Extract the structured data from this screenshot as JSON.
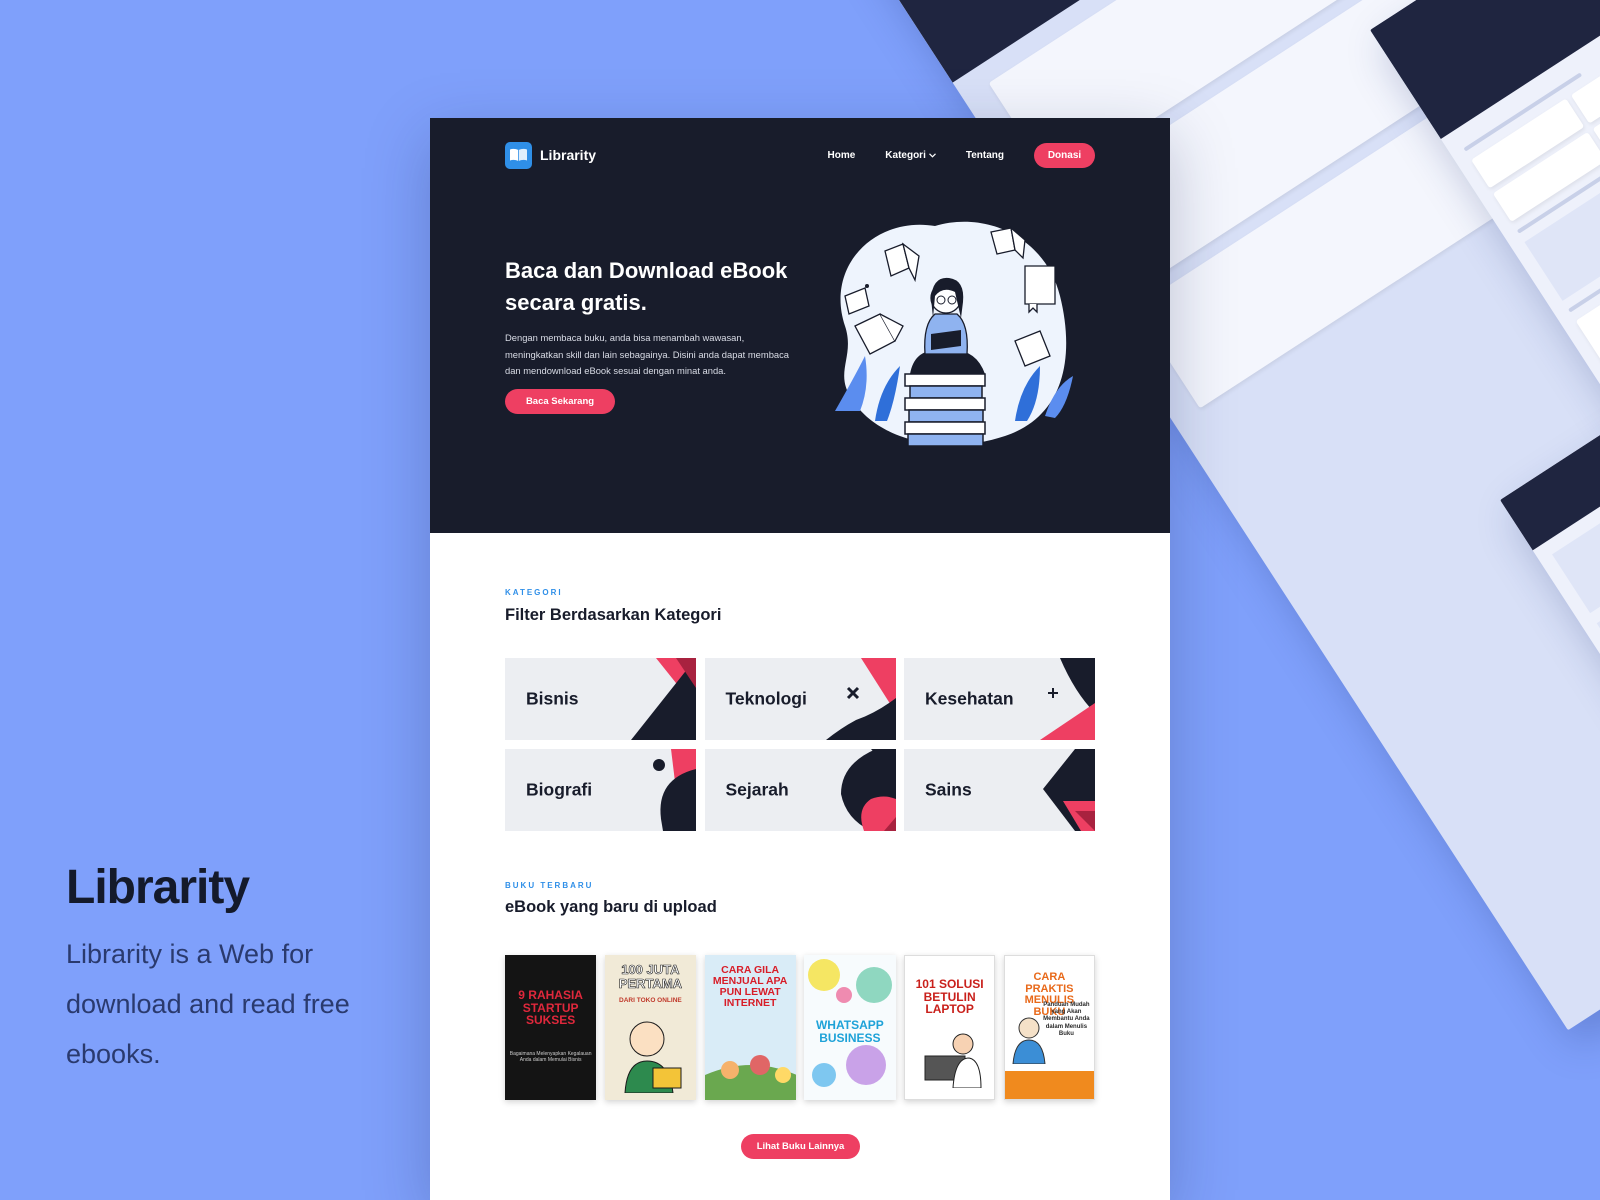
{
  "caption": {
    "title": "Librarity",
    "description": "Librarity is a Web for download and read free ebooks."
  },
  "nav": {
    "brand": "Librarity",
    "links": [
      "Home",
      "Kategori",
      "Tentang"
    ],
    "donate": "Donasi"
  },
  "hero": {
    "title": "Baca dan Download eBook secara gratis.",
    "description": "Dengan membaca buku, anda bisa menambah wawasan, meningkatkan skill dan lain sebagainya. Disini anda dapat membaca dan mendownload eBook sesuai dengan minat anda.",
    "cta": "Baca Sekarang"
  },
  "categories": {
    "label": "KATEGORI",
    "title": "Filter Berdasarkan Kategori",
    "items": [
      "Bisnis",
      "Teknologi",
      "Kesehatan",
      "Biografi",
      "Sejarah",
      "Sains"
    ]
  },
  "latest": {
    "label": "BUKU TERBARU",
    "title": "eBook yang baru di upload",
    "books": [
      {
        "title": "9 RAHASIA STARTUP SUKSES",
        "sub": "Bagaimana Melenyapkan Kegalauan Anda dalam Memulai Bisnis"
      },
      {
        "title": "100 JUTA PERTAMA",
        "sub": "DARI TOKO ONLINE"
      },
      {
        "title": "CARA GILA MENJUAL APA PUN LEWAT INTERNET",
        "sub": ""
      },
      {
        "title": "WHATSAPP BUSINESS",
        "sub": ""
      },
      {
        "title": "101 SOLUSI BETULIN LAPTOP",
        "sub": ""
      },
      {
        "title": "CARA PRAKTIS MENULIS BUKU",
        "sub": "Panduan Mudah yang Akan Membantu Anda dalam Menulis Buku"
      }
    ],
    "more": "Lihat Buku Lainnya"
  },
  "colors": {
    "accent": "#ee3f62",
    "dark": "#181c2b",
    "blue": "#2f8fe8",
    "background": "#7fa0fb"
  }
}
